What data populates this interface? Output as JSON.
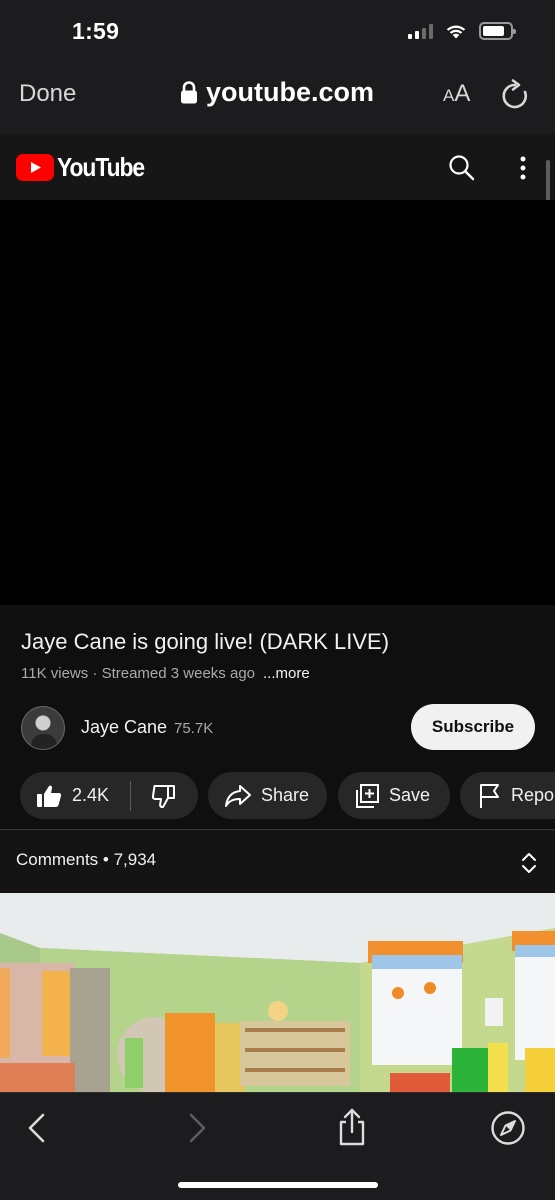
{
  "status_bar": {
    "time": "1:59"
  },
  "browser": {
    "done_label": "Done",
    "url": "youtube.com",
    "text_size_label_small": "A",
    "text_size_label_large": "A"
  },
  "youtube_header": {
    "logo_text": "YouTube",
    "brand_color": "#ff0000"
  },
  "video": {
    "title": "Jaye Cane is going live! (DARK LIVE)",
    "meta": "11K views · Streamed 3 weeks ago",
    "more_label": "...more"
  },
  "channel": {
    "name": "Jaye Cane",
    "subscribers": "75.7K",
    "subscribe_label": "Subscribe"
  },
  "actions": {
    "likes": "2.4K",
    "share_label": "Share",
    "save_label": "Save",
    "report_label": "Report"
  },
  "comments": {
    "label": "Comments • 7,934"
  },
  "icons": {
    "lock": "lock-icon",
    "reload": "reload-icon",
    "search": "search-icon",
    "more": "more-vertical-icon",
    "like": "thumbs-up-icon",
    "dislike": "thumbs-down-icon",
    "share": "share-arrow-icon",
    "save": "playlist-add-icon",
    "report": "flag-icon",
    "expand": "chevron-up-down-icon",
    "back": "chevron-left-icon",
    "forward": "chevron-right-icon",
    "share_sheet": "share-sheet-icon",
    "compass": "compass-icon"
  }
}
